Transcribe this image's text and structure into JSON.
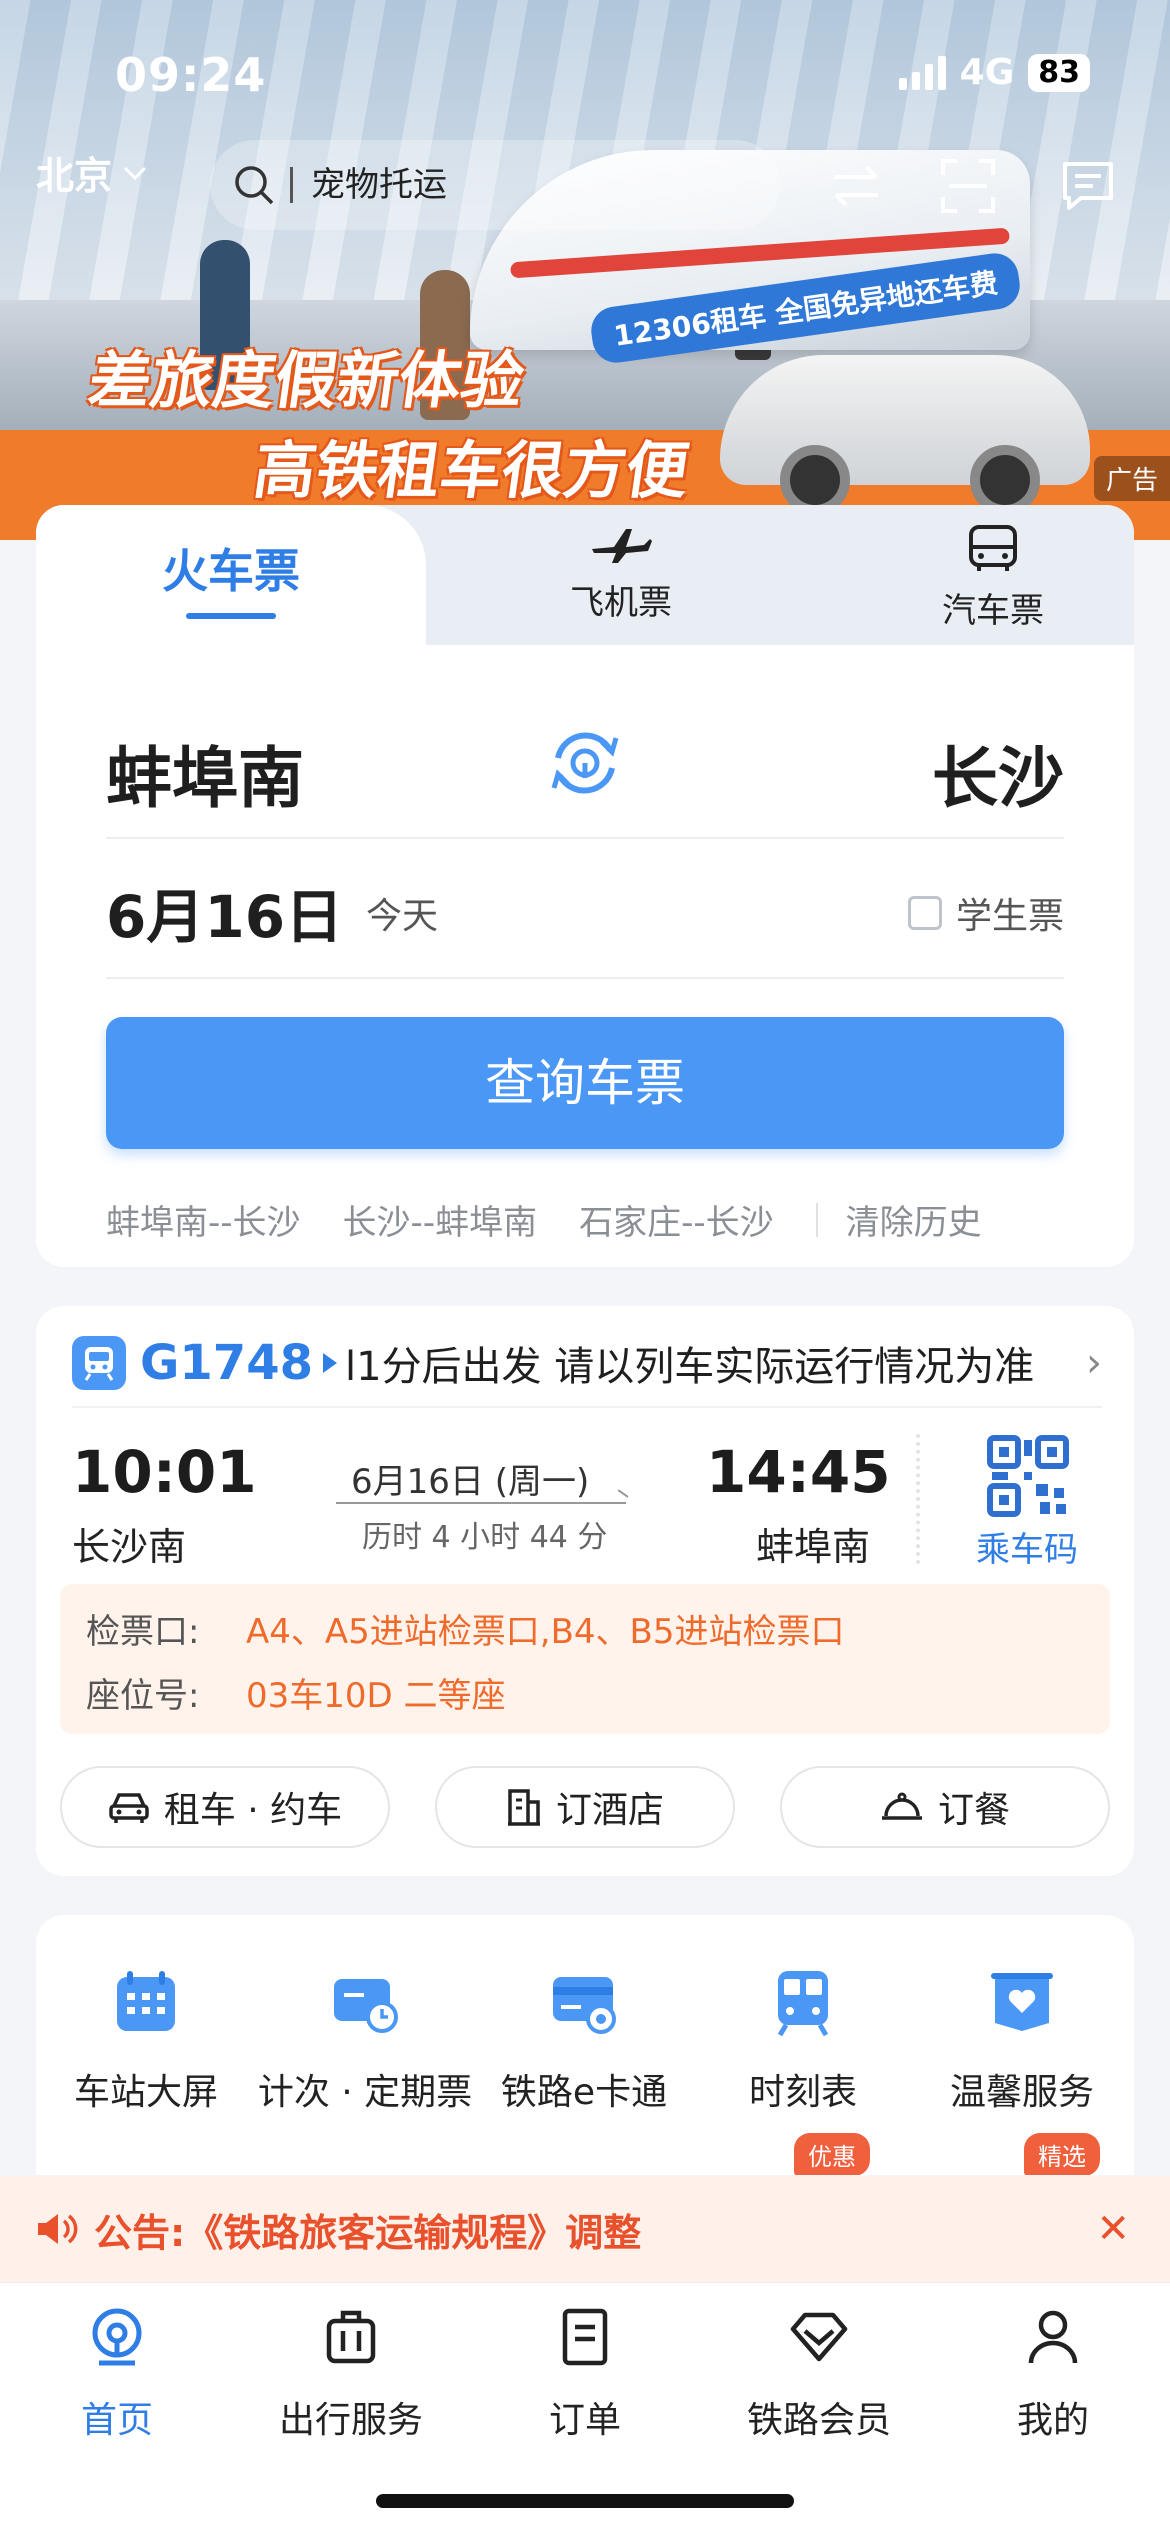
{
  "status": {
    "time": "09:24",
    "network": "4G",
    "battery": "83"
  },
  "header": {
    "city": "北京",
    "search_placeholder": "宠物托运"
  },
  "banner": {
    "slogan_line1": "差旅度假新体验",
    "slogan_line2": "高铁租车很方便",
    "promo": "12306租车 全国免异地还车费",
    "ad_label": "广告"
  },
  "booking": {
    "tabs": [
      {
        "label": "火车票",
        "icon": "train-icon"
      },
      {
        "label": "飞机票",
        "icon": "plane-icon"
      },
      {
        "label": "汽车票",
        "icon": "bus-icon"
      }
    ],
    "from_station": "蚌埠南",
    "to_station": "长沙",
    "date": "6月16日",
    "date_note": "今天",
    "student_label": "学生票",
    "query_button": "查询车票",
    "history": [
      "蚌埠南--长沙",
      "长沙--蚌埠南",
      "石家庄--长沙"
    ],
    "clear_history": "清除历史"
  },
  "trip": {
    "train_no": "G1748",
    "notice": "l1分后出发 请以列车实际运行情况为准",
    "depart_time": "10:01",
    "depart_station": "长沙南",
    "date": "6月16日 (周一)",
    "duration": "历时 4 小时 44 分",
    "arrive_time": "14:45",
    "arrive_station": "蚌埠南",
    "qr_label": "乘车码",
    "gate_label": "检票口:",
    "gate_value": "A4、A5进站检票口,B4、B5进站检票口",
    "seat_label": "座位号:",
    "seat_value": "03车10D 二等座",
    "actions": [
      "租车 · 约车",
      "订酒店",
      "订餐"
    ]
  },
  "services": {
    "items": [
      {
        "label": "车站大屏",
        "icon": "calendar-screen-icon"
      },
      {
        "label": "计次 · 定期票",
        "icon": "ticket-clock-icon"
      },
      {
        "label": "铁路e卡通",
        "icon": "ecard-icon"
      },
      {
        "label": "时刻表",
        "icon": "timetable-icon"
      },
      {
        "label": "温馨服务",
        "icon": "heart-service-icon"
      }
    ],
    "badges": [
      "优惠",
      "精选"
    ]
  },
  "announcement": {
    "text": "公告:《铁路旅客运输规程》调整"
  },
  "tabbar": {
    "items": [
      {
        "label": "首页",
        "icon": "home-icon"
      },
      {
        "label": "出行服务",
        "icon": "luggage-icon"
      },
      {
        "label": "订单",
        "icon": "order-icon"
      },
      {
        "label": "铁路会员",
        "icon": "diamond-icon"
      },
      {
        "label": "我的",
        "icon": "person-icon"
      }
    ]
  },
  "colors": {
    "accent": "#2f7ee6",
    "button": "#4b97f5",
    "warning": "#ef6b2c",
    "banner_orange": "#f07c2b"
  }
}
